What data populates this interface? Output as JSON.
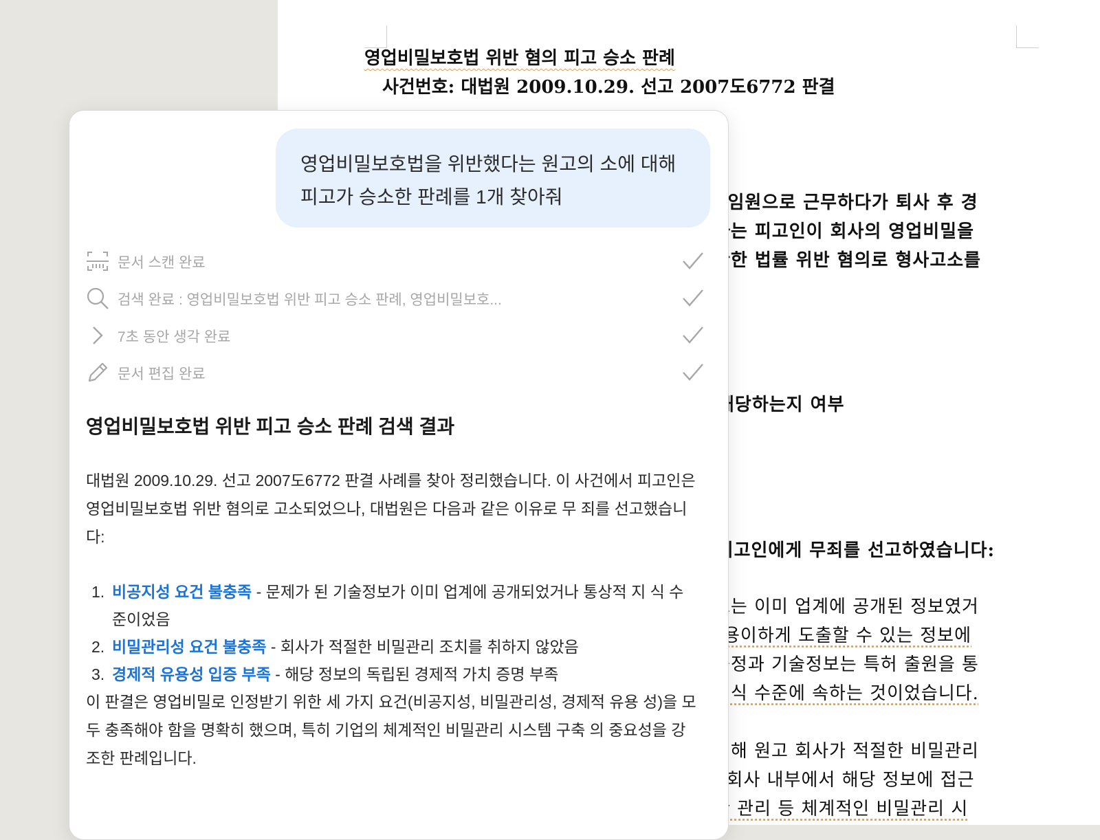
{
  "document": {
    "title": "영업비밀보호법 위반 혐의 피고 승소 판례",
    "case_number": "사건번호: 대법원 2009.10.29. 선고 2007도6772 판결",
    "visible_lines": [
      "| 임원으로 근무하다가 퇴사 후 경",
      "사는 피고인이 회사의 영업비밀을",
      "관한 법률 위반 혐의로 형사고소를",
      "해당하는지 여부",
      ": 피고인에게 무죄를 선고하였습니다:",
      "보는 이미 업계에 공개된 정보였거",
      "용이하게 도출할 수 있는 정보에",
      "공정과 기술정보는 특허 출원을 통",
      "지식 수준에 속하는 것이었습니다.",
      "대해 원고 회사가 적절한 비밀관리",
      ". 회사 내부에서 해당 정보에 접근",
      "한 관리 등 체계적인 비밀관리 시"
    ]
  },
  "chat": {
    "user_message": "영업비밀보호법을 위반했다는 원고의 소에 대해 피고가 승소한 판례를 1개 찾아줘",
    "steps": [
      {
        "icon": "scan-icon",
        "label": "문서 스캔 완료",
        "status": "done"
      },
      {
        "icon": "search-icon",
        "label": "검색 완료 : 영업비밀보호법 위반 피고 승소 판례, 영업비밀보호...",
        "status": "done"
      },
      {
        "icon": "chevron-right-icon",
        "label": "7초 동안 생각 완료",
        "status": "done"
      },
      {
        "icon": "pencil-icon",
        "label": "문서 편집 완료",
        "status": "done"
      }
    ],
    "result_title": "영업비밀보호법 위반 피고 승소 판례 검색 결과",
    "result_intro": "대법원 2009.10.29. 선고 2007도6772 판결 사례를 찾아 정리했습니다. 이 사건에서 피고인은 영업비밀보호법 위반 혐의로 고소되었으나, 대법원은 다음과 같은 이유로 무 죄를 선고했습니다:",
    "reasons": [
      {
        "num": "1.",
        "key": "비공지성 요건 불충족",
        "text": " - 문제가 된 기술정보가 이미 업계에 공개되었거나 통상적 지 식 수준이었음"
      },
      {
        "num": "2.",
        "key": "비밀관리성 요건 불충족",
        "text": " - 회사가 적절한 비밀관리 조치를 취하지 않았음"
      },
      {
        "num": "3.",
        "key": "경제적 유용성 입증 부족",
        "text": " - 해당 정보의 독립된 경제적 가치 증명 부족"
      }
    ],
    "conclusion": "이 판결은 영업비밀로 인정받기 위한 세 가지 요건(비공지성, 비밀관리성, 경제적 유용 성)을 모두 충족해야 함을 명확히 했으며, 특히 기업의 체계적인 비밀관리 시스템 구축 의 중요성을 강조한 판례입니다."
  },
  "colors": {
    "accent_blue": "#1a73d9",
    "bubble_bg": "#e6f1fd",
    "step_gray": "#a7a7a7",
    "canvas_bg": "#e7e6e1"
  }
}
